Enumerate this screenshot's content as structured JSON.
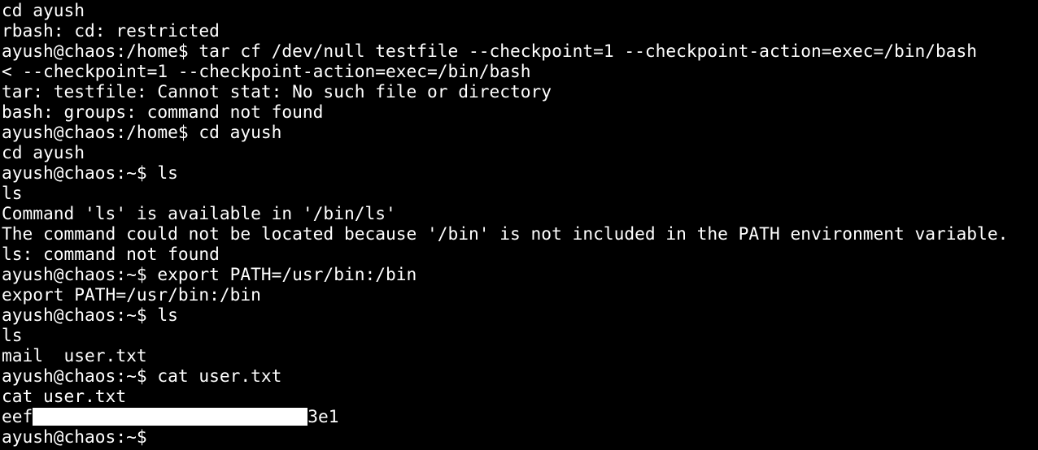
{
  "terminal": {
    "lines": [
      "cd ayush",
      "rbash: cd: restricted",
      "ayush@chaos:/home$ tar cf /dev/null testfile --checkpoint=1 --checkpoint-action=exec=/bin/bash",
      "< --checkpoint=1 --checkpoint-action=exec=/bin/bash",
      "tar: testfile: Cannot stat: No such file or directory",
      "bash: groups: command not found",
      "ayush@chaos:/home$ cd ayush",
      "cd ayush",
      "ayush@chaos:~$ ls",
      "ls",
      "Command 'ls' is available in '/bin/ls'",
      "The command could not be located because '/bin' is not included in the PATH environment variable.",
      "ls: command not found",
      "ayush@chaos:~$ export PATH=/usr/bin:/bin",
      "export PATH=/usr/bin:/bin",
      "ayush@chaos:~$ ls",
      "ls",
      "mail  user.txt",
      "ayush@chaos:~$ cat user.txt",
      "cat user.txt"
    ],
    "flag_prefix": "eef",
    "flag_suffix": "3e1",
    "prompt": "ayush@chaos:~$ ",
    "colors": {
      "background": "#000000",
      "foreground": "#ffffff"
    }
  }
}
